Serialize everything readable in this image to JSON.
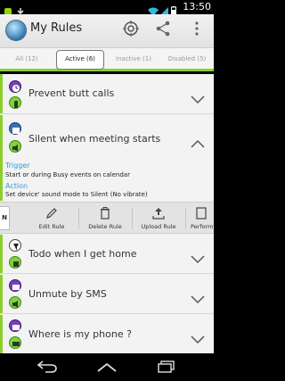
{
  "status_bar": {
    "time": "13:50"
  },
  "app": {
    "title": "My Rules"
  },
  "tabs": [
    {
      "label": "All (12)"
    },
    {
      "label": "Active (6)"
    },
    {
      "label": "Inactive (1)"
    },
    {
      "label": "Disabled (5)"
    }
  ],
  "rules": [
    {
      "name": "Prevent butt calls"
    },
    {
      "name": "Silent when meeting starts"
    },
    {
      "name": "Todo when I get home"
    },
    {
      "name": "Unmute by SMS"
    },
    {
      "name": "Where is my phone ?"
    }
  ],
  "expanded": {
    "trigger_label": "Trigger",
    "trigger_text": "Start or during Busy events on  calendar",
    "action_label": "Action",
    "action_text": "Set device' sound mode to Silent (No vibrate)"
  },
  "toolbar": {
    "first_label": "N",
    "items": [
      {
        "label": "Edit Rule"
      },
      {
        "label": "Delete Rule"
      },
      {
        "label": "Upload Rule"
      },
      {
        "label": "Perform"
      }
    ]
  },
  "colors": {
    "accent_green": "#8ccf2a",
    "label_blue": "#2b9ed8"
  }
}
